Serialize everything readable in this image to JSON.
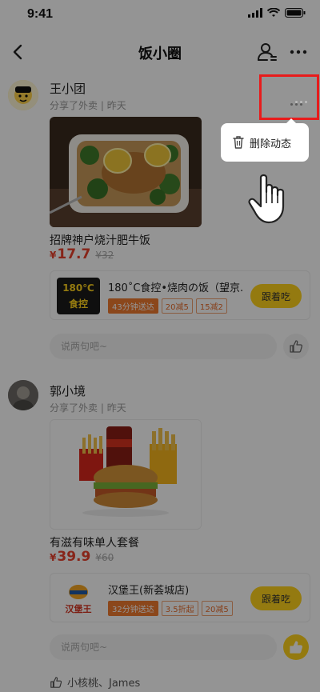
{
  "status": {
    "time": "9:41"
  },
  "nav": {
    "title": "饭小圈"
  },
  "posts": [
    {
      "author": "王小团",
      "meta": "分享了外卖",
      "time": "昨天",
      "food_name": "招牌神户烧汁肥牛饭",
      "price": "17.7",
      "original_price": "¥32",
      "currency": "¥",
      "store": {
        "logo_text_top": "180℃",
        "logo_text_bottom": "食控",
        "name": "180˚C食控•烧肉の饭（望京...",
        "tags": [
          "43分钟送达",
          "20减5",
          "15减2"
        ],
        "follow_label": "跟着吃"
      },
      "comment_placeholder": "说两句吧~"
    },
    {
      "author": "郭小境",
      "meta": "分享了外卖",
      "time": "昨天",
      "food_name": "有滋有味单人套餐",
      "price": "39.9",
      "original_price": "¥60",
      "currency": "¥",
      "store": {
        "logo_text": "汉堡王",
        "name": "汉堡王(新荟城店)",
        "tags": [
          "32分钟送达",
          "3.5折起",
          "20减5"
        ],
        "follow_label": "跟着吃"
      },
      "comment_placeholder": "说两句吧~",
      "likers": "小核桃、James"
    }
  ],
  "popup": {
    "label": "删除动态"
  },
  "colors": {
    "accent": "#ffd31c",
    "price": "#e8412c",
    "highlight": "#e81b1b"
  }
}
